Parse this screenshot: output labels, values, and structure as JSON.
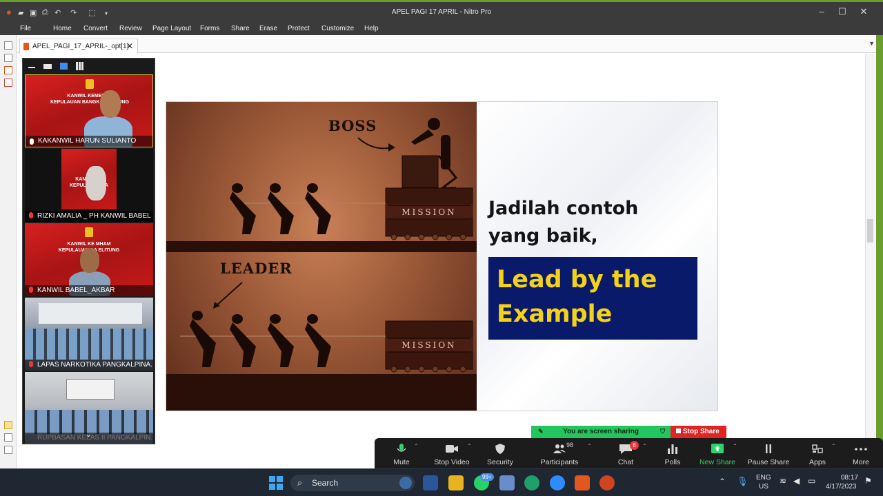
{
  "window": {
    "title": "APEL PAGI 17 APRIL - Nitro Pro",
    "controls": {
      "minimize": "–",
      "maximize": "☐",
      "close": "✕"
    }
  },
  "ribbon": {
    "file": "File",
    "tabs": [
      "Home",
      "Convert",
      "Review",
      "Page Layout",
      "Forms",
      "Share",
      "Erase",
      "Protect",
      "Customize",
      "Help"
    ]
  },
  "doc_tab": {
    "label": "APEL_PAGI_17_APRIL-_opt[1]",
    "close": "✕"
  },
  "slide": {
    "boss_label": "BOSS",
    "leader_label": "LEADER",
    "mission_label": "MISSION",
    "headline_line1": "Jadilah contoh",
    "headline_line2": "yang baik,",
    "highlight_line1": "Lead by the",
    "highlight_line2": "Example",
    "colors": {
      "box": "#0a1a6b",
      "highlight": "#f4d21a"
    }
  },
  "video_panel": {
    "participants": [
      {
        "name": "KAKANWIL HARUN SULIANTO",
        "banner1": "KANWIL KEMENKU",
        "banner2": "KEPULAUAN BANGKA BELITUNG"
      },
      {
        "name": "RIZKI AMALIA _ PH KANWIL BABEL",
        "banner1": "KANWIL KE",
        "banner2": "KEPULAUAN BA"
      },
      {
        "name": "KANWIL BABEL_AKBAR",
        "banner1": "KANWIL KE     MHAM",
        "banner2": "KEPULAUAN BA     ELITUNG"
      },
      {
        "name": "LAPAS NARKOTIKA PANGKALPINA..."
      },
      {
        "name": "RUPBASAN KELAS II PANGKALPIN..."
      }
    ]
  },
  "share_banner": {
    "status": "You are screen sharing",
    "stop": "Stop Share"
  },
  "zoom_toolbar": {
    "mute": "Mute",
    "stop_video": "Stop Video",
    "security": "Security",
    "participants": "Participants",
    "participant_count": "98",
    "chat": "Chat",
    "chat_badge": "6",
    "polls": "Polls",
    "new_share": "New Share",
    "pause_share": "Pause Share",
    "apps": "Apps",
    "more": "More"
  },
  "taskbar": {
    "search": "Search",
    "whatsapp_badge": "99+",
    "lang1": "ENG",
    "lang2": "US",
    "time": "08:17",
    "date": "4/17/2023"
  }
}
